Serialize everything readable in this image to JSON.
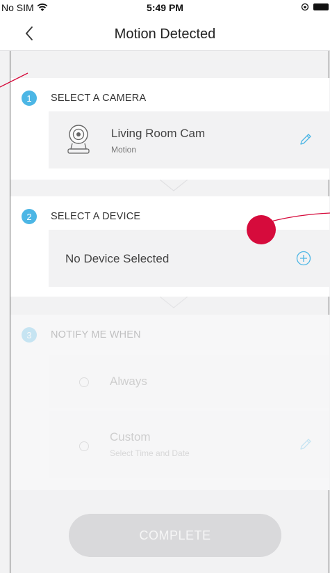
{
  "status_bar": {
    "carrier": "No SIM",
    "time": "5:49 PM"
  },
  "nav": {
    "title": "Motion Detected"
  },
  "steps": {
    "camera": {
      "number": "1",
      "label": "SELECT A CAMERA",
      "camera_name": "Living Room Cam",
      "camera_type": "Motion"
    },
    "device": {
      "number": "2",
      "label": "SELECT A DEVICE",
      "placeholder": "No Device Selected"
    },
    "notify": {
      "number": "3",
      "label": "NOTIFY ME WHEN",
      "options": [
        {
          "label": "Always"
        },
        {
          "label": "Custom",
          "sublabel": "Select Time and Date"
        }
      ]
    }
  },
  "footer": {
    "complete_label": "COMPLETE"
  },
  "colors": {
    "accent": "#4cb6e5",
    "tap_marker": "#d60b3c",
    "button_disabled": "#d9d9db"
  }
}
